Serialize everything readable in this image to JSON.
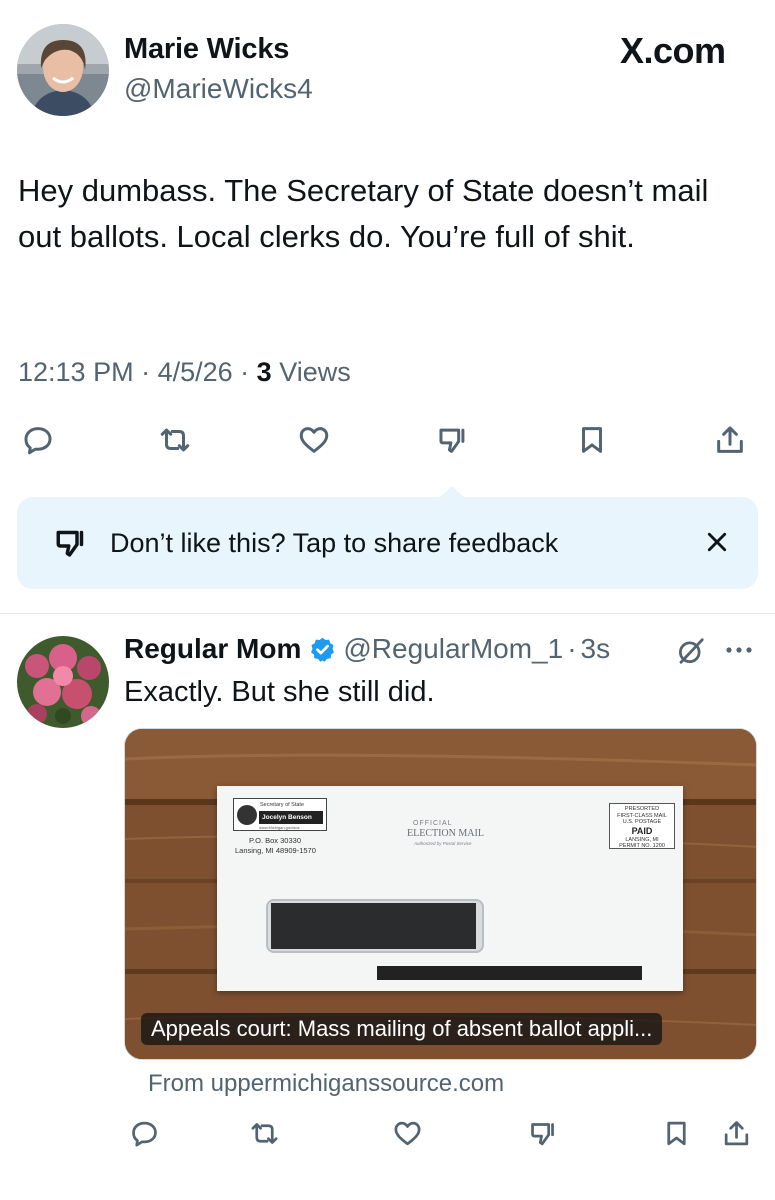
{
  "main_tweet": {
    "author_name": "Marie Wicks",
    "author_handle": "@MarieWicks4",
    "brand": "X.com",
    "text": "Hey dumbass. The Secretary of State doesn’t mail out ballots. Local clerks do. You’re full of shit.",
    "time": "12:13 PM",
    "date": "4/5/26",
    "meta_sep": " · ",
    "views_count": "3",
    "views_label": "Views",
    "actions": [
      "reply-icon",
      "retweet-icon",
      "like-icon",
      "dislike-icon",
      "bookmark-icon",
      "share-icon"
    ]
  },
  "feedback": {
    "text": "Don’t like this? Tap to share feedback",
    "icon": "dislike-icon",
    "close_icon": "close-icon"
  },
  "reply_tweet": {
    "author_name": "Regular Mom",
    "verified": true,
    "author_handle": "@RegularMom_1",
    "separator": "·",
    "time": "3s",
    "text": "Exactly. But she still did.",
    "media": {
      "caption": "Appeals court: Mass mailing of absent ballot appli...",
      "envelope": {
        "sender_title": "Secretary of State",
        "sender_name": "Jocelyn Benson",
        "sender_url": "www.Michigan.gov/sos",
        "po_box": "P.O. Box 30330",
        "city": "Lansing, MI 48909-1570",
        "official": "OFFICIAL",
        "election_mail": "ELECTION MAIL",
        "authorized": "Authorized by Postal Service",
        "postage_lines": [
          "PRESORTED",
          "FIRST-CLASS MAIL",
          "U.S. POSTAGE"
        ],
        "postage_paid": "PAID",
        "postage_lines2": [
          "LANSING, MI",
          "PERMIT NO. 1200"
        ]
      }
    },
    "source": "From uppermichiganssource.com",
    "actions": [
      "reply-icon",
      "retweet-icon",
      "like-icon",
      "dislike-icon",
      "bookmark-icon",
      "share-icon"
    ]
  },
  "colors": {
    "text_primary": "#0f1419",
    "text_secondary": "#536471",
    "feedback_bg": "#e8f5fd",
    "verified_blue": "#1d9bf0",
    "divider": "#e6e9ec"
  }
}
